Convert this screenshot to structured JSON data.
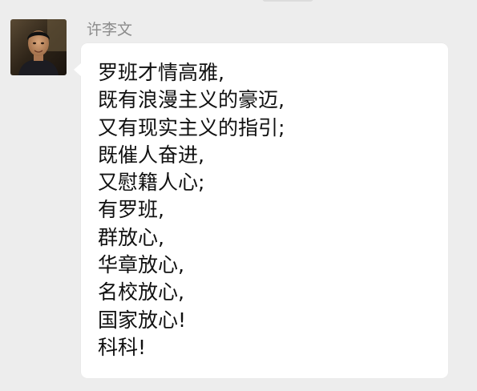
{
  "sender": {
    "name": "许李文",
    "avatar_icon": "user-avatar-photo"
  },
  "message": {
    "lines": [
      "罗班才情高雅,",
      "既有浪漫主义的豪迈,",
      "又有现实主义的指引;",
      "既催人奋进,",
      "又慰籍人心;",
      "有罗班,",
      "群放心,",
      "华章放心,",
      "名校放心,",
      "国家放心!",
      "科科!"
    ]
  },
  "colors": {
    "background": "#ededed",
    "bubble": "#ffffff",
    "name_text": "#8c8c8c",
    "message_text": "#111111"
  }
}
